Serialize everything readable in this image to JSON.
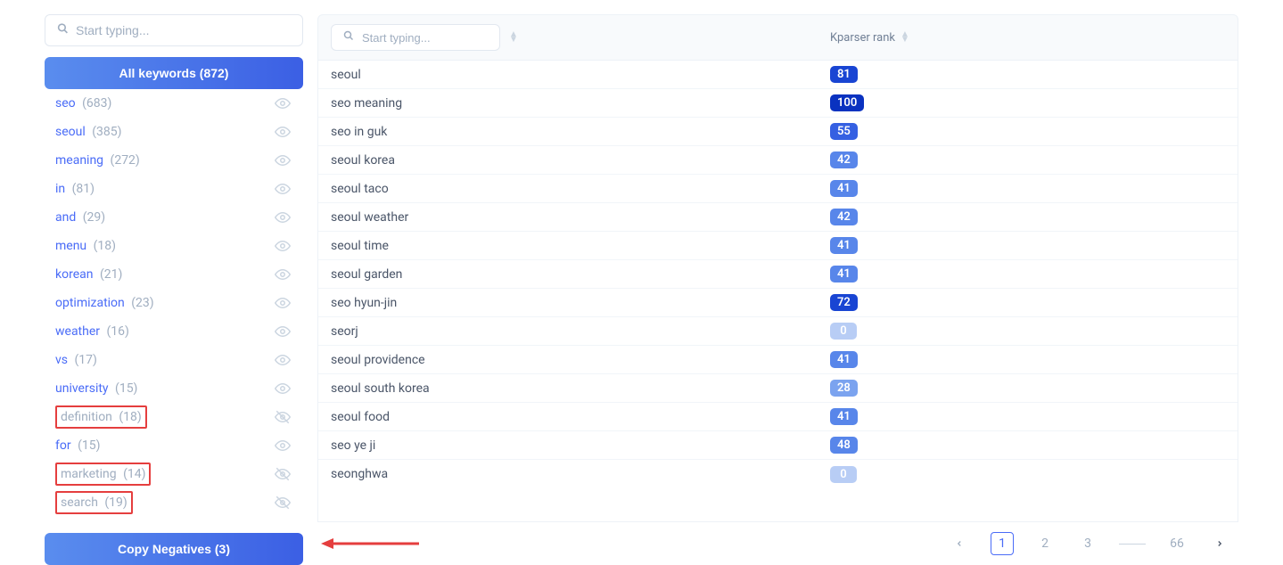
{
  "sidebar": {
    "search_placeholder": "Start typing...",
    "all_keywords_label": "All keywords (872)",
    "copy_negatives_label": "Copy Negatives (3)",
    "items": [
      {
        "label": "seo",
        "count": "(683)",
        "hidden": false,
        "boxed": false
      },
      {
        "label": "seoul",
        "count": "(385)",
        "hidden": false,
        "boxed": false
      },
      {
        "label": "meaning",
        "count": "(272)",
        "hidden": false,
        "boxed": false
      },
      {
        "label": "in",
        "count": "(81)",
        "hidden": false,
        "boxed": false
      },
      {
        "label": "and",
        "count": "(29)",
        "hidden": false,
        "boxed": false
      },
      {
        "label": "menu",
        "count": "(18)",
        "hidden": false,
        "boxed": false
      },
      {
        "label": "korean",
        "count": "(21)",
        "hidden": false,
        "boxed": false
      },
      {
        "label": "optimization",
        "count": "(23)",
        "hidden": false,
        "boxed": false
      },
      {
        "label": "weather",
        "count": "(16)",
        "hidden": false,
        "boxed": false
      },
      {
        "label": "vs",
        "count": "(17)",
        "hidden": false,
        "boxed": false
      },
      {
        "label": "university",
        "count": "(15)",
        "hidden": false,
        "boxed": false
      },
      {
        "label": "definition",
        "count": "(18)",
        "hidden": true,
        "boxed": true
      },
      {
        "label": "for",
        "count": "(15)",
        "hidden": false,
        "boxed": false
      },
      {
        "label": "marketing",
        "count": "(14)",
        "hidden": true,
        "boxed": true
      },
      {
        "label": "search",
        "count": "(19)",
        "hidden": true,
        "boxed": true
      }
    ]
  },
  "table": {
    "search_placeholder": "Start typing...",
    "rank_header": "Kparser rank",
    "rows": [
      {
        "keyword": "seoul",
        "rank": 81,
        "lvl": 4
      },
      {
        "keyword": "seo meaning",
        "rank": 100,
        "lvl": 5
      },
      {
        "keyword": "seo in guk",
        "rank": 55,
        "lvl": 3
      },
      {
        "keyword": "seoul korea",
        "rank": 42,
        "lvl": 2
      },
      {
        "keyword": "seoul taco",
        "rank": 41,
        "lvl": 2
      },
      {
        "keyword": "seoul weather",
        "rank": 42,
        "lvl": 2
      },
      {
        "keyword": "seoul time",
        "rank": 41,
        "lvl": 2
      },
      {
        "keyword": "seoul garden",
        "rank": 41,
        "lvl": 2
      },
      {
        "keyword": "seo hyun-jin",
        "rank": 72,
        "lvl": 4
      },
      {
        "keyword": "seorj",
        "rank": 0,
        "lvl": 0
      },
      {
        "keyword": "seoul providence",
        "rank": 41,
        "lvl": 2
      },
      {
        "keyword": "seoul south korea",
        "rank": 28,
        "lvl": 1
      },
      {
        "keyword": "seoul food",
        "rank": 41,
        "lvl": 2
      },
      {
        "keyword": "seo ye ji",
        "rank": 48,
        "lvl": 2
      },
      {
        "keyword": "seonghwa",
        "rank": 0,
        "lvl": 0
      }
    ]
  },
  "pagination": {
    "pages": [
      "1",
      "2",
      "3"
    ],
    "last": "66"
  }
}
